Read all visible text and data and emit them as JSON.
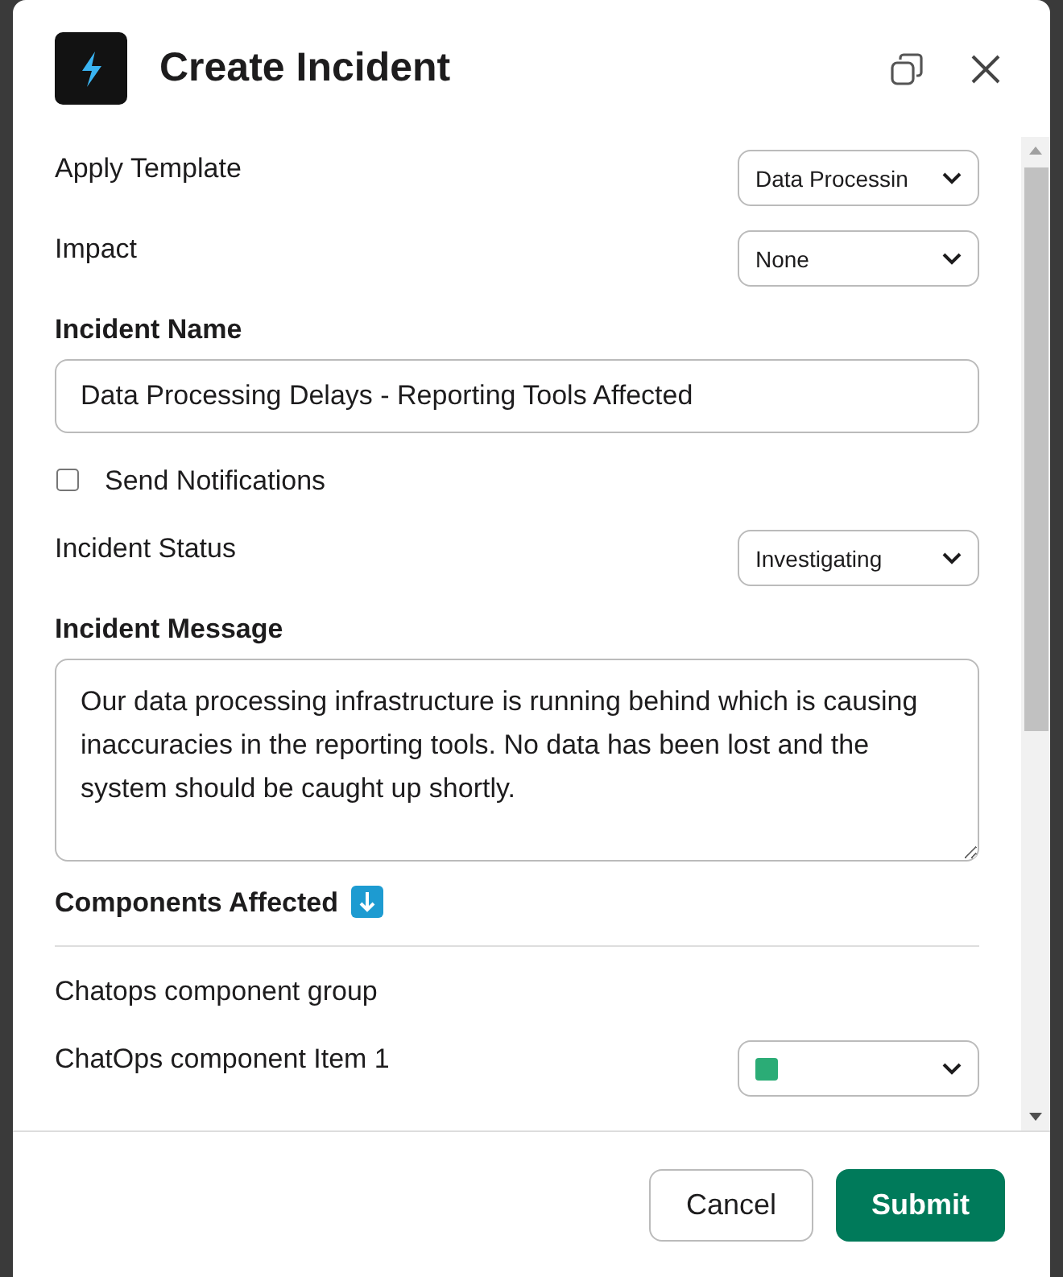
{
  "modal": {
    "title": "Create Incident"
  },
  "fields": [
    {
      "kind": "select",
      "label": "Apply Template",
      "value": "Data Processin"
    },
    {
      "kind": "select",
      "label": "Impact",
      "value": "None"
    },
    {
      "kind": "text",
      "label": "Incident Name",
      "value": "Data Processing Delays - Reporting Tools Affected"
    },
    {
      "kind": "checkbox",
      "label": "Send Notifications",
      "checked": false
    },
    {
      "kind": "select",
      "label": "Incident Status",
      "value": "Investigating"
    },
    {
      "kind": "textarea",
      "label": "Incident Message",
      "value": "Our data processing infrastructure is running behind which is causing inaccuracies in the reporting tools. No data has been lost and the system should be caught up shortly."
    }
  ],
  "components": {
    "heading": "Components Affected",
    "group": "Chatops component group",
    "items": [
      {
        "name": "ChatOps component Item 1",
        "color": "#2bac76"
      }
    ]
  },
  "buttons": {
    "cancel": "Cancel",
    "submit": "Submit"
  }
}
